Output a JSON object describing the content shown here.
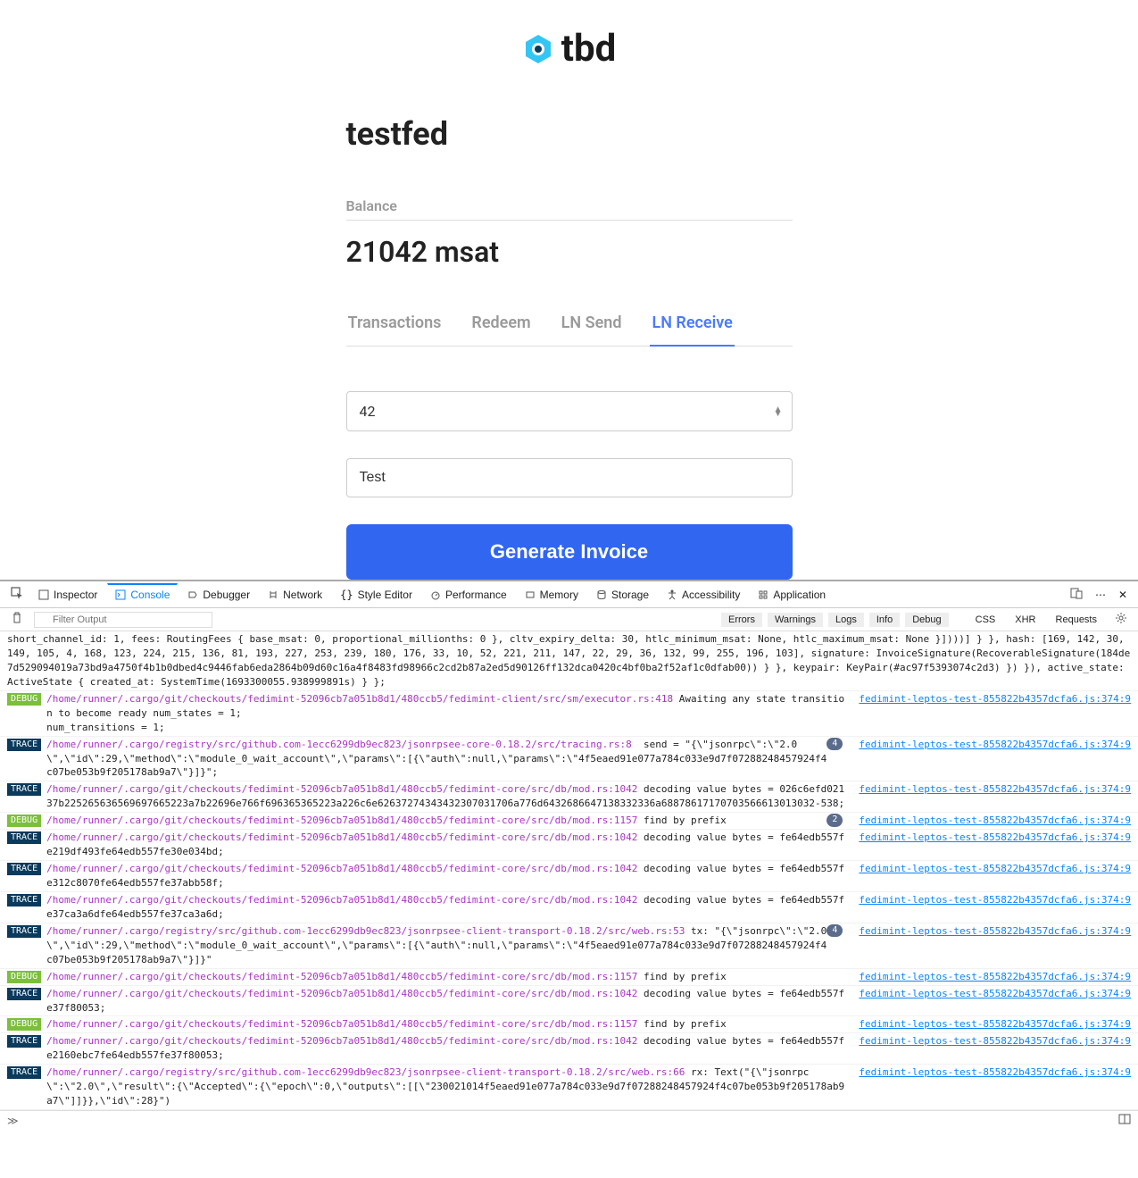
{
  "logo_text": "tbd",
  "page_title": "testfed",
  "balance": {
    "label": "Balance",
    "value": "21042 msat"
  },
  "tabs": [
    {
      "label": "Transactions",
      "active": false
    },
    {
      "label": "Redeem",
      "active": false
    },
    {
      "label": "LN Send",
      "active": false
    },
    {
      "label": "LN Receive",
      "active": true
    }
  ],
  "amount_input": {
    "value": "42"
  },
  "desc_input": {
    "value": "Test"
  },
  "generate_button": "Generate Invoice",
  "devtools": {
    "tabs": [
      "Inspector",
      "Console",
      "Debugger",
      "Network",
      "Style Editor",
      "Performance",
      "Memory",
      "Storage",
      "Accessibility",
      "Application"
    ],
    "active_tab": "Console",
    "filter_placeholder": "Filter Output",
    "level_chips": [
      "Errors",
      "Warnings",
      "Logs",
      "Info",
      "Debug"
    ],
    "category_chips": [
      "CSS",
      "XHR",
      "Requests"
    ],
    "source_link": "fedimint-leptos-test-855822b4357dcfa6.js:374:9",
    "messages": [
      {
        "level": null,
        "count": null,
        "src": "",
        "body": "short_channel_id: 1, fees: RoutingFees { base_msat: 0, proportional_millionths: 0 }, cltv_expiry_delta: 30, htlc_minimum_msat: None, htlc_maximum_msat: None }])))] } }, hash: [169, 142, 30, 149, 105, 4, 168, 123, 224, 215, 136, 81, 193, 227, 253, 239, 180, 176, 33, 10, 52, 221, 211, 147, 22, 29, 36, 132, 99, 255, 196, 103], signature: InvoiceSignature(RecoverableSignature(184de7d529094019a73bd9a4750f4b1b0dbed4c9446fab6eda2864b09d60c16a4f8483fd98966c2cd2b87a2ed5d90126ff132dca0420c4bf0ba2f52af1c0dfab00)) } }, keypair: KeyPair(#ac97f5393074c2d3) }) }), active_state: ActiveState { created_at: SystemTime(1693300055.938999891s) } };",
        "link": false
      },
      {
        "level": "DEBUG",
        "count": null,
        "src": "/home/runner/.cargo/git/checkouts/fedimint-52096cb7a051b8d1/480ccb5/fedimint-client/src/sm/executor.rs:418",
        "body": " Awaiting any state transition to become ready num_states = 1;\nnum_transitions = 1;",
        "link": true
      },
      {
        "level": "TRACE",
        "count": "4",
        "src": "/home/runner/.cargo/registry/src/github.com-1ecc6299db9ec823/jsonrpsee-core-0.18.2/src/tracing.rs:8",
        "body": "  send = \"{\\\"jsonrpc\\\":\\\"2.0\\\",\\\"id\\\":29,\\\"method\\\":\\\"module_0_wait_account\\\",\\\"params\\\":[{\\\"auth\\\":null,\\\"params\\\":\\\"4f5eaed91e077a784c033e9d7f07288248457924f4c07be053b9f205178ab9a7\\\"}]}\";",
        "link": true
      },
      {
        "level": "TRACE",
        "count": null,
        "src": "/home/runner/.cargo/git/checkouts/fedimint-52096cb7a051b8d1/480ccb5/fedimint-core/src/db/mod.rs:1042",
        "body": " decoding value bytes = 026c6efd02137b225265636569697665223a7b22696e766f696365365223a226c6e62637274343432307031706a776d6432686647138332336a68878617170703566613013032-538;",
        "link": true
      },
      {
        "level": "DEBUG",
        "count": "2",
        "src": "/home/runner/.cargo/git/checkouts/fedimint-52096cb7a051b8d1/480ccb5/fedimint-core/src/db/mod.rs:1157",
        "body": " find by prefix",
        "link": true
      },
      {
        "level": "TRACE",
        "count": null,
        "src": "/home/runner/.cargo/git/checkouts/fedimint-52096cb7a051b8d1/480ccb5/fedimint-core/src/db/mod.rs:1042",
        "body": " decoding value bytes = fe64edb557fe219df493fe64edb557fe30e034bd;",
        "link": true
      },
      {
        "level": "TRACE",
        "count": null,
        "src": "/home/runner/.cargo/git/checkouts/fedimint-52096cb7a051b8d1/480ccb5/fedimint-core/src/db/mod.rs:1042",
        "body": " decoding value bytes = fe64edb557fe312c8070fe64edb557fe37abb58f;",
        "link": true
      },
      {
        "level": "TRACE",
        "count": null,
        "src": "/home/runner/.cargo/git/checkouts/fedimint-52096cb7a051b8d1/480ccb5/fedimint-core/src/db/mod.rs:1042",
        "body": " decoding value bytes = fe64edb557fe37ca3a6dfe64edb557fe37ca3a6d;",
        "link": true
      },
      {
        "level": "TRACE",
        "count": "4",
        "src": "/home/runner/.cargo/registry/src/github.com-1ecc6299db9ec823/jsonrpsee-client-transport-0.18.2/src/web.rs:53",
        "body": " tx: \"{\\\"jsonrpc\\\":\\\"2.0\\\",\\\"id\\\":29,\\\"method\\\":\\\"module_0_wait_account\\\",\\\"params\\\":[{\\\"auth\\\":null,\\\"params\\\":\\\"4f5eaed91e077a784c033e9d7f07288248457924f4c07be053b9f205178ab9a7\\\"}]}\"",
        "link": true
      },
      {
        "level": "DEBUG",
        "count": null,
        "src": "/home/runner/.cargo/git/checkouts/fedimint-52096cb7a051b8d1/480ccb5/fedimint-core/src/db/mod.rs:1157",
        "body": " find by prefix",
        "link": true
      },
      {
        "level": "TRACE",
        "count": null,
        "src": "/home/runner/.cargo/git/checkouts/fedimint-52096cb7a051b8d1/480ccb5/fedimint-core/src/db/mod.rs:1042",
        "body": " decoding value bytes = fe64edb557fe37f80053;",
        "link": true
      },
      {
        "level": "DEBUG",
        "count": null,
        "src": "/home/runner/.cargo/git/checkouts/fedimint-52096cb7a051b8d1/480ccb5/fedimint-core/src/db/mod.rs:1157",
        "body": " find by prefix",
        "link": true
      },
      {
        "level": "TRACE",
        "count": null,
        "src": "/home/runner/.cargo/git/checkouts/fedimint-52096cb7a051b8d1/480ccb5/fedimint-core/src/db/mod.rs:1042",
        "body": " decoding value bytes = fe64edb557fe2160ebc7fe64edb557fe37f80053;",
        "link": true
      },
      {
        "level": "TRACE",
        "count": null,
        "src": "/home/runner/.cargo/registry/src/github.com-1ecc6299db9ec823/jsonrpsee-client-transport-0.18.2/src/web.rs:66",
        "body": " rx: Text(\"{\\\"jsonrpc\\\":\\\"2.0\\\",\\\"result\\\":{\\\"Accepted\\\":{\\\"epoch\\\":0,\\\"outputs\\\":[[\\\"230021014f5eaed91e077a784c033e9d7f07288248457924f4c07be053b9f205178ab9a7\\\"]]}},\\\"id\\\":28}\")",
        "link": true
      }
    ]
  }
}
